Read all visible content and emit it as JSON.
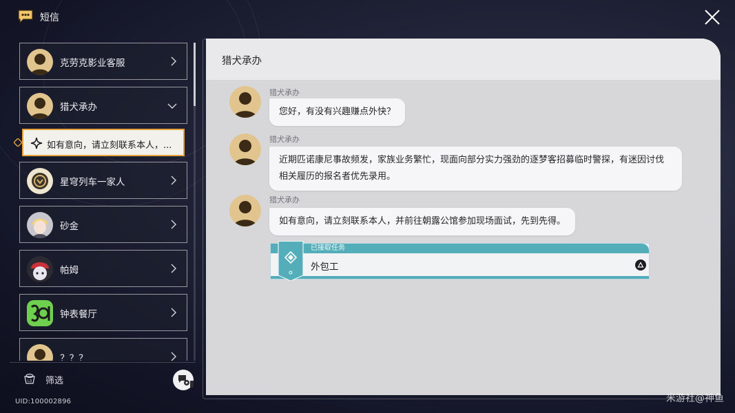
{
  "app": {
    "title": "短信",
    "icon": "message-bubble-icon"
  },
  "contacts": [
    {
      "name": "克劳克影业客服",
      "avatar": "silhouette-avatar",
      "expanded": false
    },
    {
      "name": "猎犬承办",
      "avatar": "silhouette-avatar",
      "expanded": true
    },
    {
      "name": "星穹列车一家人",
      "avatar": "train-emblem-avatar",
      "expanded": false
    },
    {
      "name": "砂金",
      "avatar": "blond-character-avatar",
      "expanded": false
    },
    {
      "name": "帕姆",
      "avatar": "pom-pom-avatar",
      "expanded": false
    },
    {
      "name": "钟表餐厅",
      "avatar": "clock-restaurant-avatar",
      "expanded": false
    },
    {
      "name": "？？？",
      "avatar": "silhouette-avatar",
      "expanded": false
    }
  ],
  "selected_thread": {
    "preview": "如有意向，请立刻联系本人，..."
  },
  "footer": {
    "filter_label": "筛选",
    "filter_key": "L3",
    "uid": "UID:100002896"
  },
  "chat": {
    "title": "猎犬承办",
    "messages": [
      {
        "sender": "猎犬承办",
        "text": "您好，有没有兴趣赚点外快？"
      },
      {
        "sender": "猎犬承办",
        "text": "近期匹诺康尼事故频发，家族业务繁忙，现面向部分实力强劲的逐梦客招募临时警探，有迷因讨伐相关履历的报名者优先录用。"
      },
      {
        "sender": "猎犬承办",
        "text": "如有意向，请立刻联系本人，并前往朝露公馆参加现场面试，先到先得。"
      }
    ],
    "mission": {
      "status": "已接取任务",
      "name": "外包工"
    }
  },
  "watermark": "米游社@神鱼",
  "colors": {
    "accent_orange": "#e8a33a",
    "mission_teal": "#53aeb9",
    "panel_bg": "#d7d6d9"
  }
}
